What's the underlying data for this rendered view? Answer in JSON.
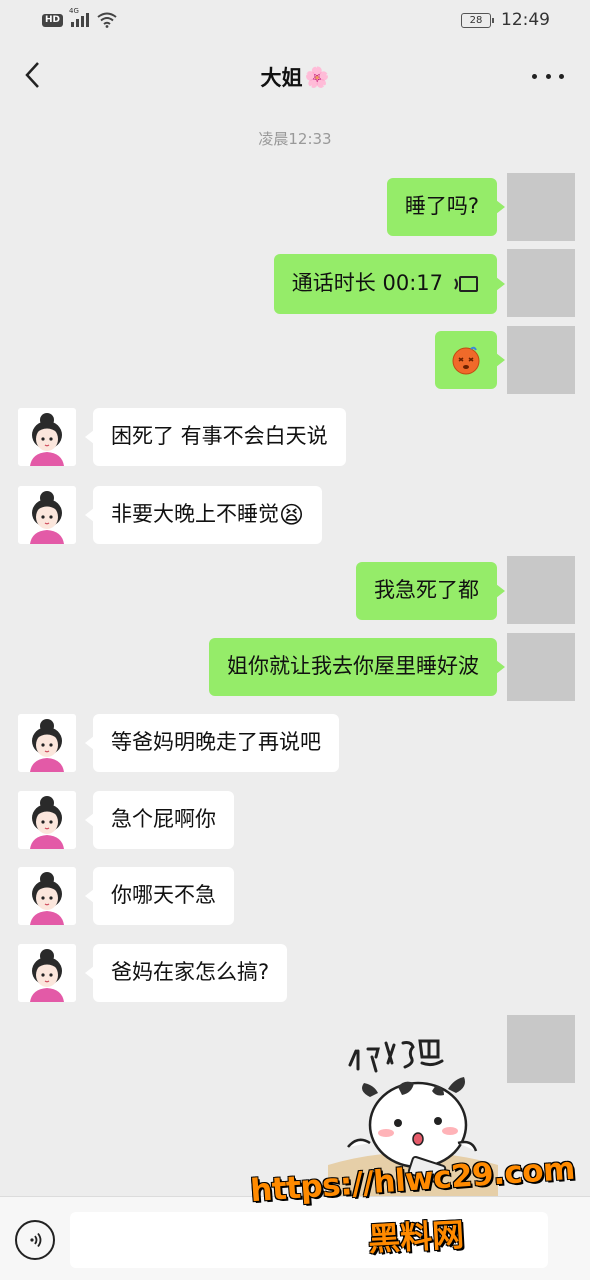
{
  "status_bar": {
    "hd_badge": "HD",
    "network": "4G",
    "battery_level": "28",
    "time": "12:49"
  },
  "header": {
    "title": "大姐",
    "title_emoji": "🌸"
  },
  "timestamp": "凌晨12:33",
  "messages": [
    {
      "side": "out",
      "type": "text",
      "text": "睡了吗?"
    },
    {
      "side": "out",
      "type": "call",
      "text": "通话时长 00:17",
      "icon": "voice-call-icon"
    },
    {
      "side": "out",
      "type": "emoji",
      "emoji": "😵"
    },
    {
      "side": "in",
      "type": "text",
      "text": "困死了  有事不会白天说"
    },
    {
      "side": "in",
      "type": "text",
      "text": "非要大晚上不睡觉",
      "emoji": "😫"
    },
    {
      "side": "out",
      "type": "text",
      "text": "我急死了都"
    },
    {
      "side": "out",
      "type": "text",
      "text": "姐你就让我去你屋里睡好波"
    },
    {
      "side": "in",
      "type": "text",
      "text": "等爸妈明晚走了再说吧"
    },
    {
      "side": "in",
      "type": "text",
      "text": "急个屁啊你"
    },
    {
      "side": "in",
      "type": "text",
      "text": "你哪天不急"
    },
    {
      "side": "in",
      "type": "text",
      "text": "爸妈在家怎么搞?"
    },
    {
      "side": "out",
      "type": "sticker",
      "text": "那好吧"
    }
  ],
  "input_bar": {
    "voice_icon": "voice-input-icon",
    "value": ""
  },
  "watermark": {
    "url": "https://hlwc29.com",
    "name": "黑料网"
  }
}
